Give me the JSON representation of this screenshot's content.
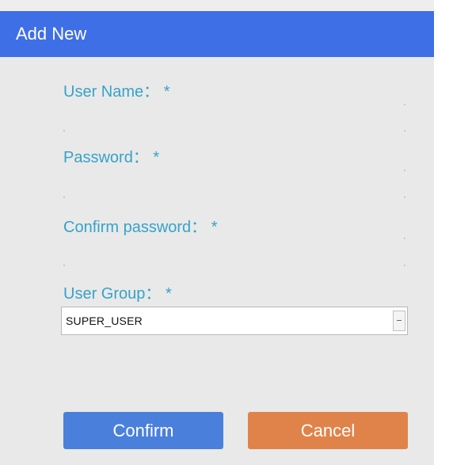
{
  "dialog": {
    "title": "Add New",
    "header_color": "#3f6fe6"
  },
  "form": {
    "username_label": "User Name：",
    "password_label": "Password：",
    "confirm_password_label": "Confirm password：",
    "user_group_label": "User Group：",
    "required_marker": "*",
    "username_value": "",
    "password_value": "",
    "confirm_password_value": "",
    "user_group_selected": "SUPER_USER",
    "label_color": "#35a3c9"
  },
  "buttons": {
    "confirm_label": "Confirm",
    "cancel_label": "Cancel",
    "confirm_color": "#4a80dc",
    "cancel_color": "#e0834a"
  }
}
